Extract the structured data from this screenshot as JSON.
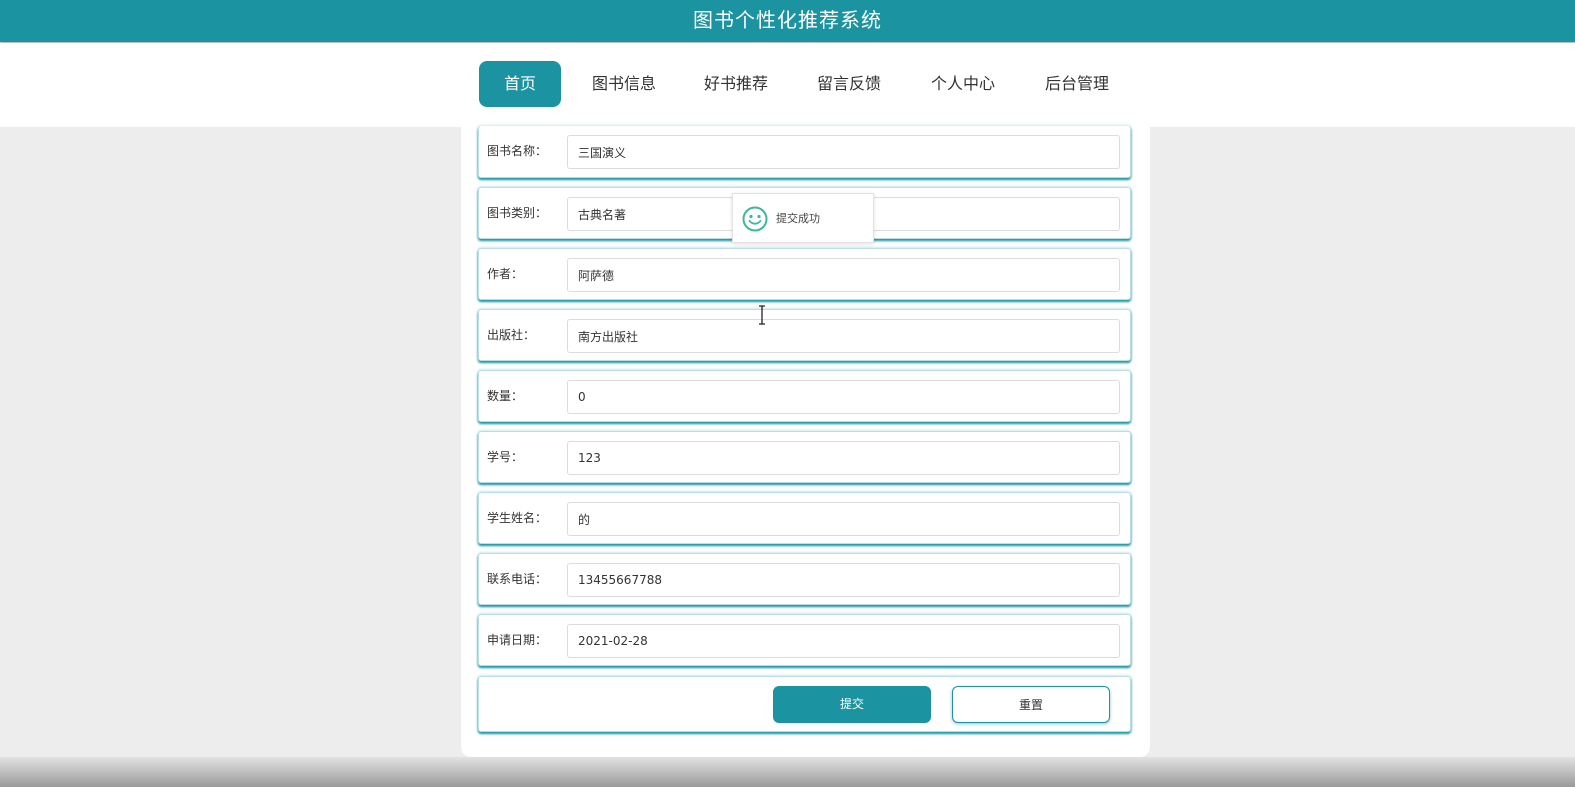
{
  "header": {
    "title": "图书个性化推荐系统"
  },
  "nav": {
    "items": [
      {
        "label": "首页",
        "active": true
      },
      {
        "label": "图书信息",
        "active": false
      },
      {
        "label": "好书推荐",
        "active": false
      },
      {
        "label": "留言反馈",
        "active": false
      },
      {
        "label": "个人中心",
        "active": false
      },
      {
        "label": "后台管理",
        "active": false
      }
    ]
  },
  "form": {
    "fields": [
      {
        "label": "图书名称：",
        "value": "三国演义"
      },
      {
        "label": "图书类别：",
        "value": "古典名著"
      },
      {
        "label": "作者：",
        "value": "阿萨德"
      },
      {
        "label": "出版社：",
        "value": "南方出版社"
      },
      {
        "label": "数量：",
        "value": "0"
      },
      {
        "label": "学号：",
        "value": "123"
      },
      {
        "label": "学生姓名：",
        "value": "的"
      },
      {
        "label": "联系电话：",
        "value": "13455667788"
      },
      {
        "label": "申请日期：",
        "value": "2021-02-28"
      }
    ],
    "submit_label": "提交",
    "reset_label": "重置"
  },
  "toast": {
    "message": "提交成功",
    "icon": "smiley-icon"
  },
  "colors": {
    "primary": "#1b93a1",
    "background": "#ededed"
  }
}
